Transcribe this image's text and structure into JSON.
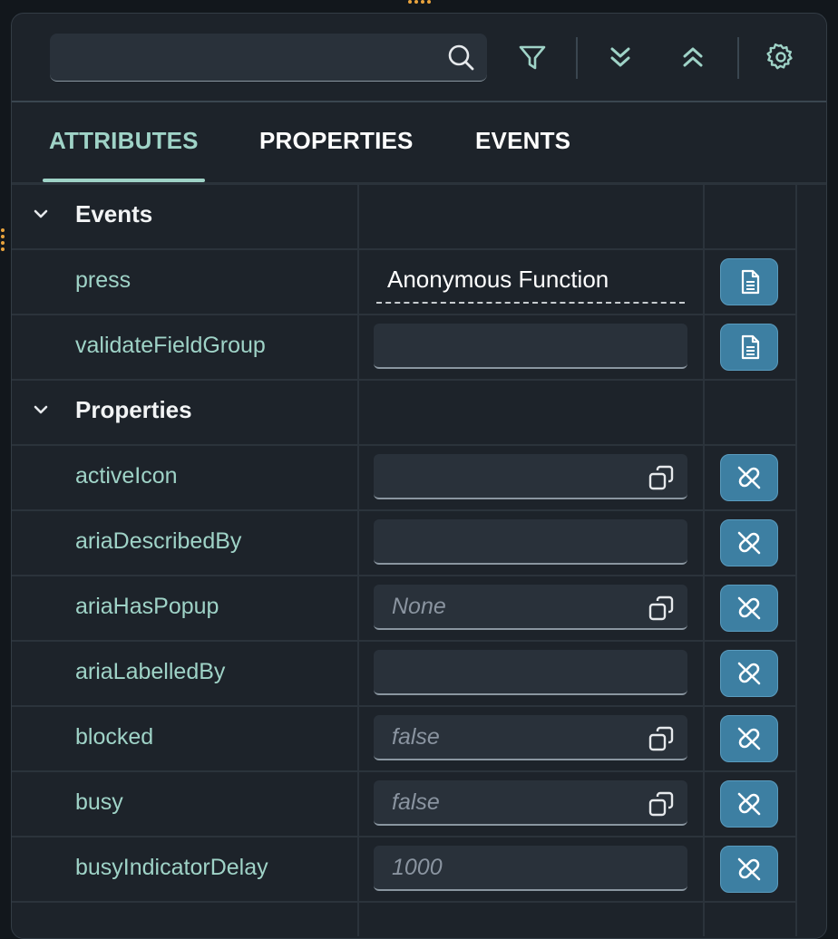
{
  "toolbar": {
    "search": {
      "value": "",
      "placeholder": ""
    },
    "icons": [
      "search-icon",
      "filter-icon",
      "expand-all-icon",
      "collapse-all-icon",
      "settings-icon"
    ]
  },
  "tabs": [
    {
      "label": "ATTRIBUTES",
      "active": true
    },
    {
      "label": "PROPERTIES",
      "active": false
    },
    {
      "label": "EVENTS",
      "active": false
    }
  ],
  "groups": {
    "events": {
      "label": "Events",
      "rows": [
        {
          "name": "press",
          "value": "Anonymous Function",
          "action_icon": "document-icon"
        },
        {
          "name": "validateFieldGroup",
          "value": "",
          "action_icon": "document-icon"
        }
      ]
    },
    "properties": {
      "label": "Properties",
      "rows": [
        {
          "name": "activeIcon",
          "placeholder": "",
          "action_icon": "unbind-icon"
        },
        {
          "name": "ariaDescribedBy",
          "placeholder": "",
          "action_icon": "unbind-icon"
        },
        {
          "name": "ariaHasPopup",
          "placeholder": "None",
          "action_icon": "unbind-icon"
        },
        {
          "name": "ariaLabelledBy",
          "placeholder": "",
          "action_icon": "unbind-icon"
        },
        {
          "name": "blocked",
          "placeholder": "false",
          "action_icon": "unbind-icon"
        },
        {
          "name": "busy",
          "placeholder": "false",
          "action_icon": "unbind-icon"
        },
        {
          "name": "busyIndicatorDelay",
          "placeholder": "1000",
          "action_icon": "unbind-icon"
        }
      ]
    }
  },
  "colors": {
    "background": "#1d232a",
    "accent": "#9fd3c7",
    "button": "#3d7fa2",
    "field": "#29313a"
  }
}
